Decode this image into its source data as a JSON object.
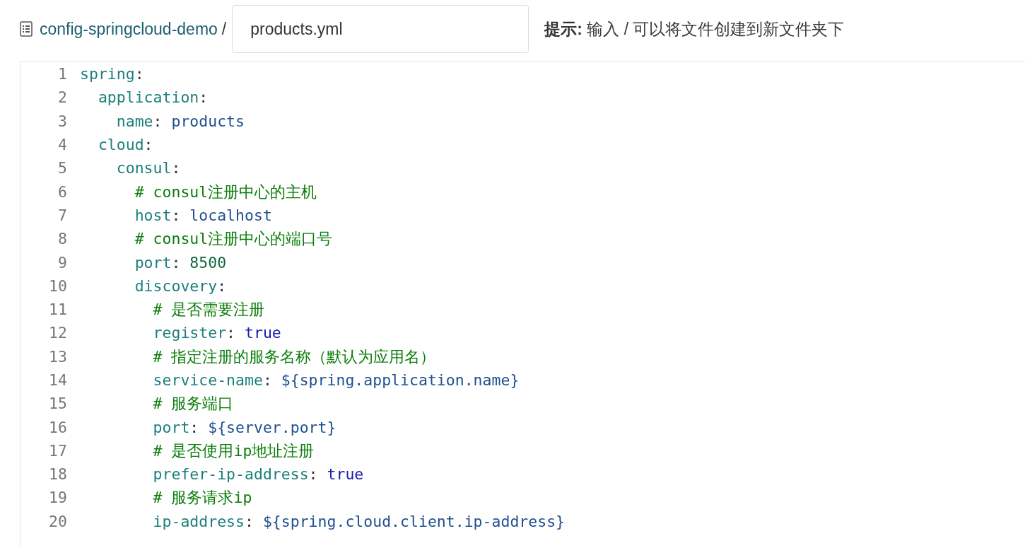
{
  "breadcrumb": {
    "repo": "config-springcloud-demo",
    "separator": "/"
  },
  "filename_field": {
    "value": "products.yml"
  },
  "hint": "**提示:** 输入 / 可以将文件创建到新文件夹下",
  "editor": {
    "lines": [
      {
        "number": "1",
        "tokens": [
          {
            "kind": "key",
            "text": "spring"
          },
          {
            "kind": "punct",
            "text": ":"
          }
        ]
      },
      {
        "number": "2",
        "tokens": [
          {
            "kind": "key",
            "text": "  application"
          },
          {
            "kind": "punct",
            "text": ":"
          }
        ]
      },
      {
        "number": "3",
        "tokens": [
          {
            "kind": "key",
            "text": "    name"
          },
          {
            "kind": "punct",
            "text": ": "
          },
          {
            "kind": "string",
            "text": "products"
          }
        ]
      },
      {
        "number": "4",
        "tokens": [
          {
            "kind": "key",
            "text": "  cloud"
          },
          {
            "kind": "punct",
            "text": ":"
          }
        ]
      },
      {
        "number": "5",
        "tokens": [
          {
            "kind": "key",
            "text": "    consul"
          },
          {
            "kind": "punct",
            "text": ":"
          }
        ]
      },
      {
        "number": "6",
        "tokens": [
          {
            "kind": "comment",
            "text": "      # consul注册中心的主机"
          }
        ]
      },
      {
        "number": "7",
        "tokens": [
          {
            "kind": "key",
            "text": "      host"
          },
          {
            "kind": "punct",
            "text": ": "
          },
          {
            "kind": "string",
            "text": "localhost"
          }
        ]
      },
      {
        "number": "8",
        "tokens": [
          {
            "kind": "comment",
            "text": "      # consul注册中心的端口号"
          }
        ]
      },
      {
        "number": "9",
        "tokens": [
          {
            "kind": "key",
            "text": "      port"
          },
          {
            "kind": "punct",
            "text": ": "
          },
          {
            "kind": "number",
            "text": "8500"
          }
        ]
      },
      {
        "number": "10",
        "tokens": [
          {
            "kind": "key",
            "text": "      discovery"
          },
          {
            "kind": "punct",
            "text": ":"
          }
        ]
      },
      {
        "number": "11",
        "tokens": [
          {
            "kind": "comment",
            "text": "        # 是否需要注册"
          }
        ]
      },
      {
        "number": "12",
        "tokens": [
          {
            "kind": "key",
            "text": "        register"
          },
          {
            "kind": "punct",
            "text": ": "
          },
          {
            "kind": "bool",
            "text": "true"
          }
        ]
      },
      {
        "number": "13",
        "tokens": [
          {
            "kind": "comment",
            "text": "        # 指定注册的服务名称（默认为应用名）"
          }
        ]
      },
      {
        "number": "14",
        "tokens": [
          {
            "kind": "key",
            "text": "        service-name"
          },
          {
            "kind": "punct",
            "text": ": "
          },
          {
            "kind": "string",
            "text": "${spring.application.name}"
          }
        ]
      },
      {
        "number": "15",
        "tokens": [
          {
            "kind": "comment",
            "text": "        # 服务端口"
          }
        ]
      },
      {
        "number": "16",
        "tokens": [
          {
            "kind": "key",
            "text": "        port"
          },
          {
            "kind": "punct",
            "text": ": "
          },
          {
            "kind": "string",
            "text": "${server.port}"
          }
        ]
      },
      {
        "number": "17",
        "tokens": [
          {
            "kind": "comment",
            "text": "        # 是否使用ip地址注册"
          }
        ]
      },
      {
        "number": "18",
        "tokens": [
          {
            "kind": "key",
            "text": "        prefer-ip-address"
          },
          {
            "kind": "punct",
            "text": ": "
          },
          {
            "kind": "bool",
            "text": "true"
          }
        ]
      },
      {
        "number": "19",
        "tokens": [
          {
            "kind": "comment",
            "text": "        # 服务请求ip"
          }
        ]
      },
      {
        "number": "20",
        "tokens": [
          {
            "kind": "key",
            "text": "        ip-address"
          },
          {
            "kind": "punct",
            "text": ": "
          },
          {
            "kind": "string",
            "text": "${spring.cloud.client.ip-address}"
          }
        ]
      }
    ]
  }
}
